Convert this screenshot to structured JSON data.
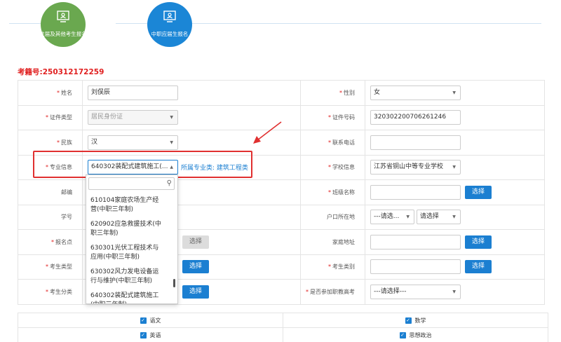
{
  "steps": [
    {
      "label": "往届及其他考生报名",
      "color": "#6aa84f"
    },
    {
      "label": "中职应届生报名",
      "color": "#1b86d6"
    }
  ],
  "reg": {
    "label": "考籍号:",
    "number": "250312172259"
  },
  "form": {
    "name": {
      "label": "姓名",
      "value": "刘俣辰"
    },
    "gender": {
      "label": "性别",
      "value": "女"
    },
    "id_type": {
      "label": "证件类型",
      "value": "居民身份证"
    },
    "id_number": {
      "label": "证件号码",
      "value": "320302200706261246"
    },
    "ethnicity": {
      "label": "民族",
      "value": "汉"
    },
    "phone": {
      "label": "联系电话",
      "value": ""
    },
    "major": {
      "label": "专业信息",
      "value": "640302装配式建筑施工(...",
      "category": "所属专业类: 建筑工程类"
    },
    "school": {
      "label": "学校信息",
      "value": "江苏省铜山中等专业学校"
    },
    "postcode": {
      "label": "邮编",
      "value": ""
    },
    "class_name": {
      "label": "班级名称",
      "value": "",
      "button": "选择"
    },
    "student_no": {
      "label": "学号",
      "value": ""
    },
    "hukou": {
      "label": "户口所在地",
      "province": "---请选...",
      "city": "请选择"
    },
    "site": {
      "label": "报名点",
      "button": "选择"
    },
    "address": {
      "label": "家庭地址",
      "button": "选择"
    },
    "exam_type": {
      "label": "考生类型",
      "button": "选择"
    },
    "exam_category": {
      "label": "考生类别",
      "button": "选择"
    },
    "exam_class": {
      "label": "考生分类",
      "button": "选择"
    },
    "vocational": {
      "label": "是否参加职教高考",
      "value": "---请选择---"
    }
  },
  "dropdown": {
    "search": "",
    "items": [
      "610104家庭农场生产经营(中职三年制)",
      "620902应急救援技术(中职三年制)",
      "630301光伏工程技术与应用(中职三年制)",
      "630302风力发电设备运行与维护(中职三年制)",
      "640302装配式建筑施工(中职三年制)"
    ]
  },
  "subjects": [
    {
      "left": "语文",
      "right": "数学"
    },
    {
      "left": "英语",
      "right": "思想政治"
    }
  ],
  "colors": {
    "accent": "#1b7fd1",
    "highlight": "#e03030",
    "required": "#e02020"
  },
  "icons": {
    "step": "monitor-user-icon",
    "check": "checkbox-checked-icon",
    "search": "search-icon"
  }
}
